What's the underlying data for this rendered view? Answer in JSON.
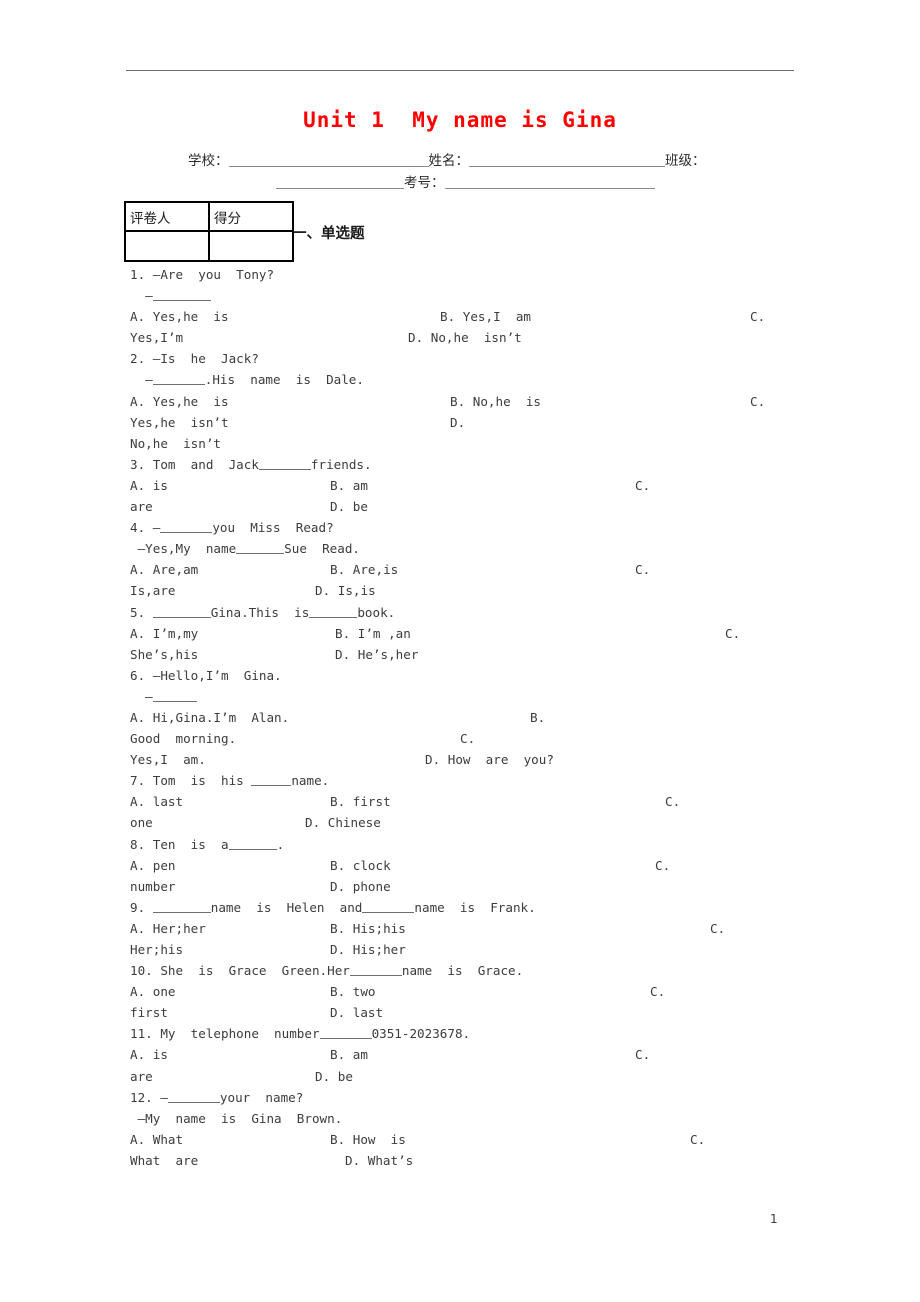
{
  "document": {
    "title": "Unit 1  My name is Gina",
    "title_color": "#ff0000",
    "page_number": "1"
  },
  "info": {
    "school_label": "学校：",
    "name_label": "姓名：",
    "class_label": "班级：",
    "exam_number_label": "考号：",
    "school_value": "",
    "name_value": "",
    "class_value": "",
    "exam_number_value": ""
  },
  "score_table": {
    "headers": [
      "评卷人",
      "得分"
    ],
    "values": [
      "",
      ""
    ]
  },
  "section": {
    "heading": "一、单选题"
  },
  "questions": [
    {
      "number": "1.",
      "stem_lines": [
        "1. —Are  you  Tony?",
        "  —"
      ],
      "options": {
        "a": "A. Yes,he  is",
        "b": "B. Yes,I  am",
        "c": "C.",
        "c_cont": "Yes,I’m",
        "d": "D. No,he  isn’t"
      }
    },
    {
      "number": "2.",
      "stem_lines": [
        "2. —Is  he  Jack?",
        "  —",
        ".His  name  is  Dale."
      ],
      "options": {
        "a": "A. Yes,he  is",
        "b": "B. No,he  is",
        "c": "C.",
        "c_cont": "Yes,he  isn’t",
        "d": "D.",
        "d_cont": "No,he  isn’t"
      }
    },
    {
      "number": "3.",
      "stem_lines": [
        "3. Tom  and  Jack",
        "friends."
      ],
      "options": {
        "a": "A. is",
        "b": "B. am",
        "c": "C.",
        "c_cont": "are",
        "d": "D. be"
      }
    },
    {
      "number": "4.",
      "stem_lines": [
        "4. —",
        "you  Miss  Read?",
        " —Yes,My  name",
        "Sue  Read."
      ],
      "options": {
        "a": "A. Are,am",
        "b": "B. Are,is",
        "c": "C.",
        "c_cont": "Is,are",
        "d": "D. Is,is"
      }
    },
    {
      "number": "5.",
      "stem_lines": [
        "5. ",
        "Gina.This  is",
        "book."
      ],
      "options": {
        "a": "A. I’m,my",
        "b": "B. I’m ,an",
        "c": "C.",
        "c_cont": "She’s,his",
        "d": "D. He’s,her"
      }
    },
    {
      "number": "6.",
      "stem_lines": [
        "6. —Hello,I’m  Gina.",
        "  —"
      ],
      "options": {
        "a": "A. Hi,Gina.I’m  Alan.",
        "b": "B.",
        "b_cont": "Good  morning.",
        "c": "C.",
        "c_cont": "Yes,I  am.",
        "d": "D. How  are  you?"
      }
    },
    {
      "number": "7.",
      "stem_lines": [
        "7. Tom  is  his ",
        "name."
      ],
      "options": {
        "a": "A. last",
        "b": "B. first",
        "c": "C.",
        "c_cont": "one",
        "d": "D. Chinese"
      }
    },
    {
      "number": "8.",
      "stem_lines": [
        "8. Ten  is  a",
        "."
      ],
      "options": {
        "a": "A. pen",
        "b": "B. clock",
        "c": "C.",
        "c_cont": "number",
        "d": "D. phone"
      }
    },
    {
      "number": "9.",
      "stem_lines": [
        "9. ",
        "name  is  Helen  and",
        "name  is  Frank."
      ],
      "options": {
        "a": "A. Her;her",
        "b": "B. His;his",
        "c": "C.",
        "c_cont": "Her;his",
        "d": "D. His;her"
      }
    },
    {
      "number": "10.",
      "stem_lines": [
        "10. She  is  Grace  Green.Her",
        "name  is  Grace."
      ],
      "options": {
        "a": "A. one",
        "b": "B. two",
        "c": "C.",
        "c_cont": "first",
        "d": "D. last"
      }
    },
    {
      "number": "11.",
      "stem_lines": [
        "11. My  telephone  number",
        "0351-2023678."
      ],
      "options": {
        "a": "A. is",
        "b": "B. am",
        "c": "C.",
        "c_cont": "are",
        "d": "D. be"
      }
    },
    {
      "number": "12.",
      "stem_lines": [
        "12. —",
        "your  name?",
        " —My  name  is  Gina  Brown."
      ],
      "options": {
        "a": "A. What",
        "b": "B. How  is",
        "c": "C.",
        "c_cont": "What  are",
        "d": "D. What’s"
      }
    }
  ]
}
